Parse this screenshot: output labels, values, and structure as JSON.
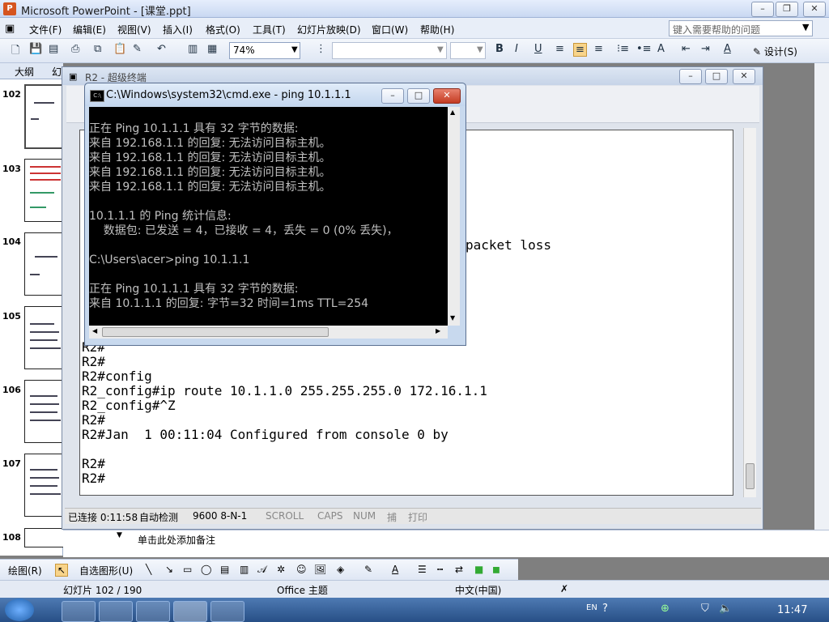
{
  "ppt": {
    "title": "Microsoft PowerPoint - [课堂.ppt]",
    "menu": [
      "文件(F)",
      "编辑(E)",
      "视图(V)",
      "插入(I)",
      "格式(O)",
      "工具(T)",
      "幻灯片放映(D)",
      "窗口(W)",
      "帮助(H)"
    ],
    "help_placeholder": "键入需要帮助的问题",
    "zoom": "74%",
    "design_label": "设计(S)",
    "panel_tabs": [
      "大纲",
      "幻"
    ],
    "slides": [
      "102",
      "103",
      "104",
      "105",
      "106",
      "107",
      "108"
    ],
    "notes_placeholder": "单击此处添加备注",
    "draw_label": "绘图(R)",
    "autoshape_label": "自选图形(U)",
    "status": {
      "slide": "幻灯片 102 / 190",
      "theme": "Office 主题",
      "lang": "中文(中国)"
    }
  },
  "terminal": {
    "title": "R2 - 超级终端",
    "lines": [
      "",
      "",
      "",
      "",
      "",
      "",
      "",
      "packet loss",
      "",
      "",
      "",
      "",
      "",
      "",
      "R2#",
      "R2#",
      "R2#config",
      "R2_config#ip route 10.1.1.0 255.255.255.0 172.16.1.1",
      "R2_config#^Z",
      "R2#",
      "R2#Jan  1 00:11:04 Configured from console 0 by",
      "",
      "R2#",
      "R2#"
    ],
    "status": {
      "connected": "已连接 0:11:58",
      "detect": "自动检测",
      "baud": "9600 8-N-1",
      "scroll": "SCROLL",
      "caps": "CAPS",
      "num": "NUM",
      "capture": "捕",
      "print": "打印"
    }
  },
  "cmd": {
    "title": "C:\\Windows\\system32\\cmd.exe - ping  10.1.1.1",
    "lines": [
      "正在 Ping 10.1.1.1 具有 32 字节的数据:",
      "来自 192.168.1.1 的回复: 无法访问目标主机。",
      "来自 192.168.1.1 的回复: 无法访问目标主机。",
      "来自 192.168.1.1 的回复: 无法访问目标主机。",
      "来自 192.168.1.1 的回复: 无法访问目标主机。",
      "",
      "10.1.1.1 的 Ping 统计信息:",
      "    数据包: 已发送 = 4，已接收 = 4，丢失 = 0 (0% 丢失)，",
      "",
      "C:\\Users\\acer>ping 10.1.1.1",
      "",
      "正在 Ping 10.1.1.1 具有 32 字节的数据:",
      "来自 10.1.1.1 的回复: 字节=32 时间=1ms TTL=254"
    ]
  },
  "taskbar": {
    "clock": "11:47",
    "lang_indicator": "EN"
  },
  "colors": {
    "cmd_bg": "#000000",
    "cmd_text": "#c0c0c0",
    "accent": "#274f86"
  }
}
